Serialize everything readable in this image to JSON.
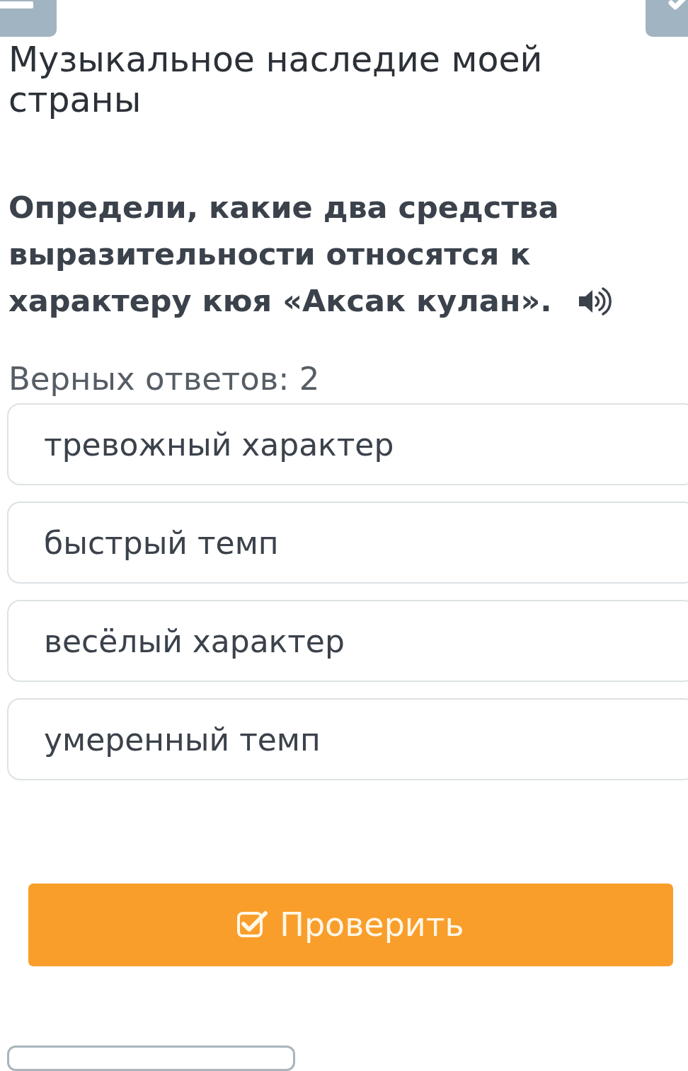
{
  "lesson_title": "Музыкальное наследие моей страны",
  "question": {
    "text": "Определи, какие два средства выразительности относятся к характеру кюя «Аксак кулан».",
    "audio": true
  },
  "answer_count": "Верных ответов: 2",
  "options": [
    {
      "label": "тревожный характер",
      "selected": false
    },
    {
      "label": "быстрый темп",
      "selected": false
    },
    {
      "label": "весёлый характер",
      "selected": false
    },
    {
      "label": "умеренный темп",
      "selected": false
    }
  ],
  "check_button": {
    "label": "Проверить"
  }
}
